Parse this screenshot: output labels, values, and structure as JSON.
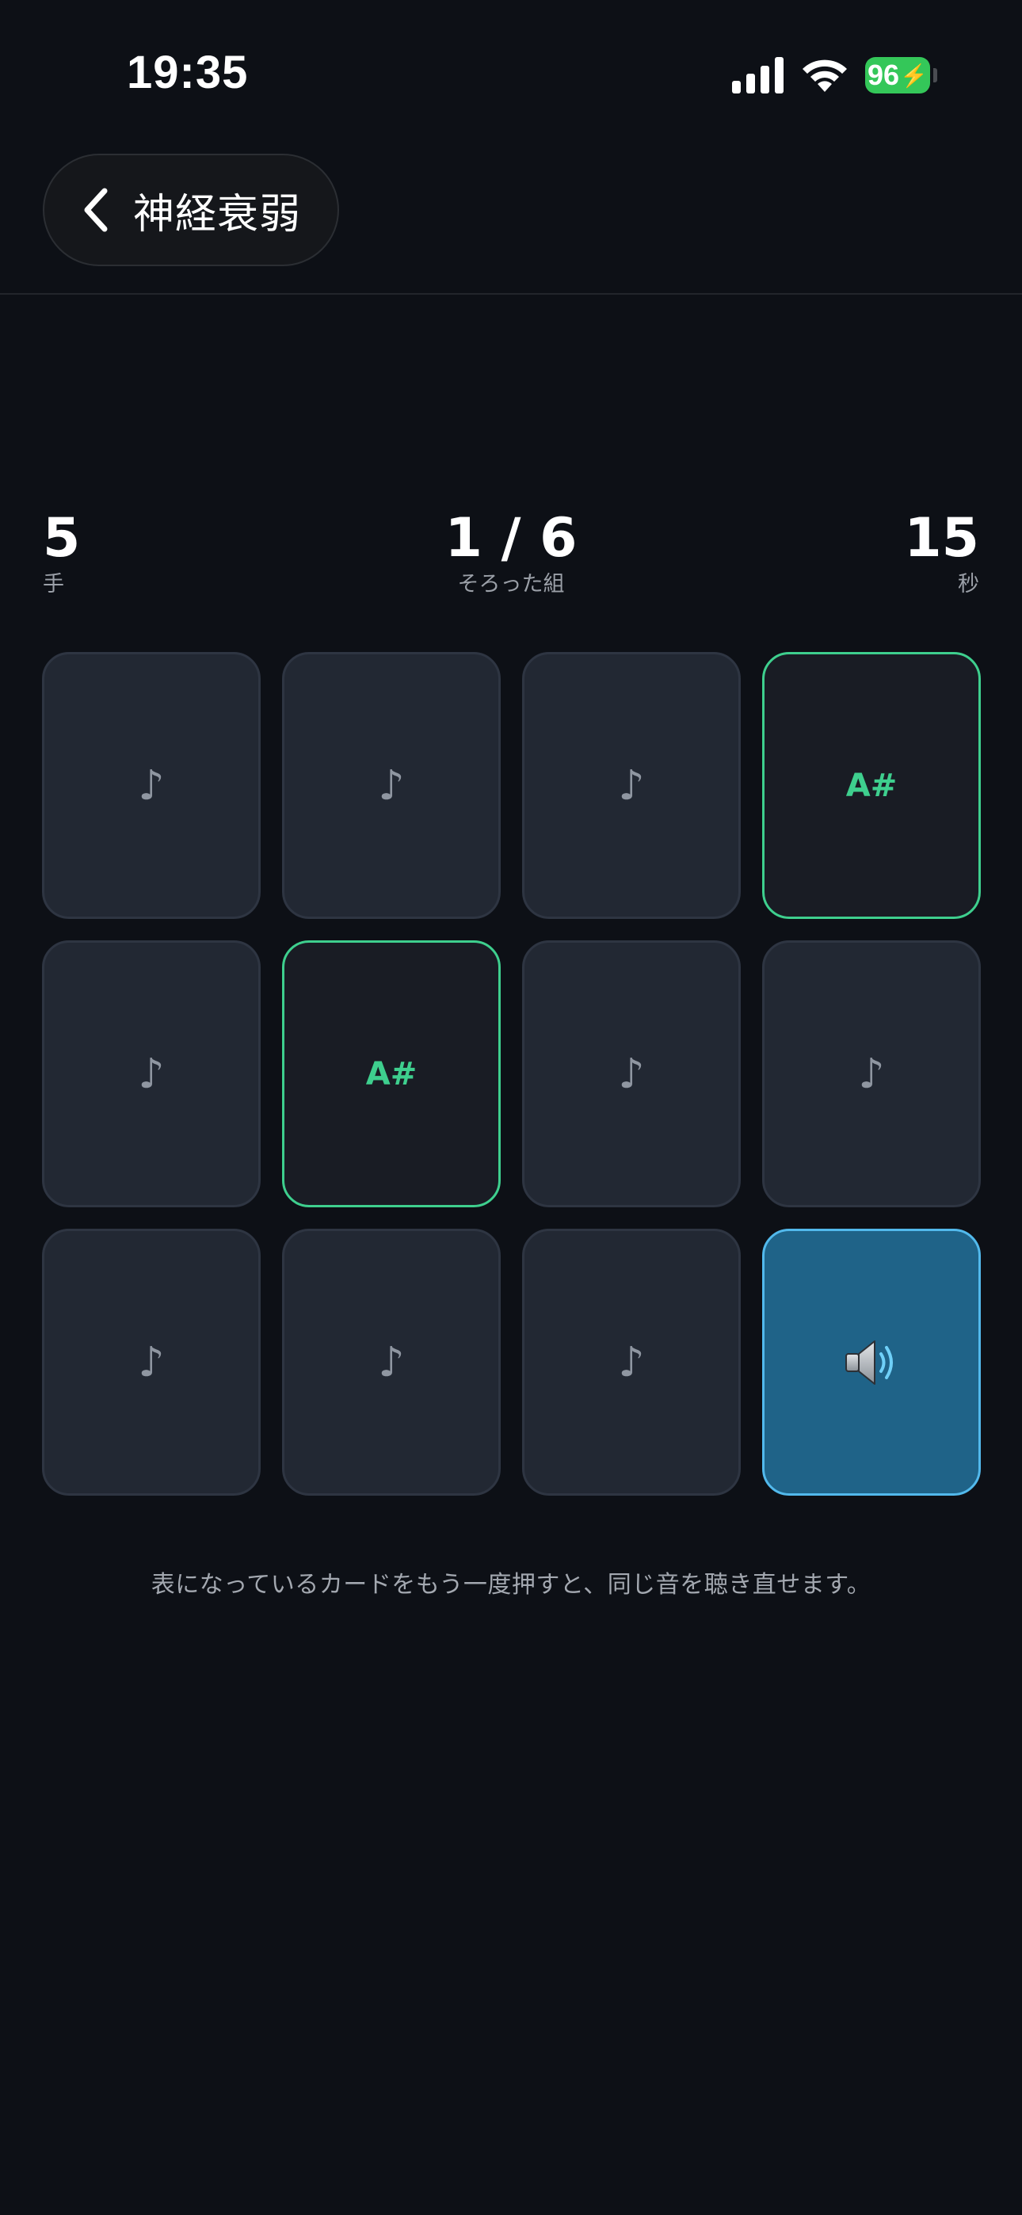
{
  "status_bar": {
    "time": "19:35",
    "battery_level": "96",
    "icons": [
      "cellular-signal-icon",
      "wifi-icon",
      "battery-charging-icon"
    ]
  },
  "header": {
    "back_icon": "chevron-left-icon",
    "title": "神経衰弱"
  },
  "stats": {
    "moves": {
      "value": "5",
      "label": "手"
    },
    "pairs": {
      "value": "1 / 6",
      "label": "そろった組"
    },
    "time": {
      "value": "15",
      "label": "秒"
    }
  },
  "cards": [
    {
      "state": "hidden",
      "face": "♪"
    },
    {
      "state": "hidden",
      "face": "♪"
    },
    {
      "state": "hidden",
      "face": "♪"
    },
    {
      "state": "revealed",
      "face": "A#"
    },
    {
      "state": "hidden",
      "face": "♪"
    },
    {
      "state": "revealed",
      "face": "A#"
    },
    {
      "state": "hidden",
      "face": "♪"
    },
    {
      "state": "hidden",
      "face": "♪"
    },
    {
      "state": "hidden",
      "face": "♪"
    },
    {
      "state": "hidden",
      "face": "♪"
    },
    {
      "state": "hidden",
      "face": "♪"
    },
    {
      "state": "playing",
      "face": "speaker-icon"
    }
  ],
  "hint": "表になっているカードをもう一度押すと、同じ音を聴き直せます。",
  "colors": {
    "background": "#0d1016",
    "card_hidden": "#222833",
    "card_matched_border": "#3ecf8e",
    "card_playing": "#1f6388",
    "card_playing_border": "#52b9ec",
    "battery": "#34c759"
  }
}
